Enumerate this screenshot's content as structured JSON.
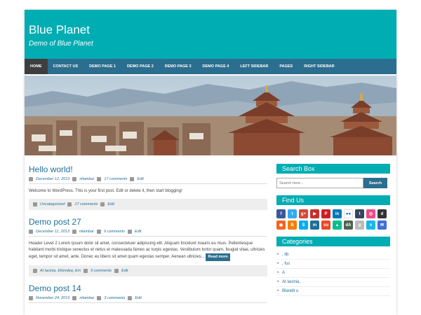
{
  "site": {
    "title": "Blue Planet",
    "description": "Demo of Blue Planet"
  },
  "nav": {
    "items": [
      "HOME",
      "CONTACT US",
      "DEMO PAGE 1",
      "DEMO PAGE 2",
      "DEMO PAGE 3",
      "DEMO PAGE 4",
      "LEFT SIDEBAR",
      "PAGES",
      "RIGHT SIDEBAR"
    ],
    "active": "HOME"
  },
  "posts": [
    {
      "title": "Hello world!",
      "date": "December 12, 2013",
      "author": "nilambar",
      "comments": "17 comments",
      "edit": "Edit",
      "excerpt": "Welcome to WordPress. This is your first post. Edit or delete it, then start blogging!",
      "categories": "Uncategorized",
      "footer_comments": "17 comments",
      "footer_edit": "Edit"
    },
    {
      "title": "Demo post 27",
      "date": "December 11, 2013",
      "author": "nilambar",
      "comments": "9 comments",
      "edit": "Edit",
      "excerpt": "Header Level 2 Lorem ipsum dolor sit amet, consectetuer adipiscing elit. Aliquam tincidunt mauris eu risus. Pellentesque habitant morbi tristique senectus et netus et malesuada fames ac turpis egestas. Vestibulum tortor quam, feugiat vitae, ultricies eget, tempor sit amet, ante. Donec eu libero sit amet quam egestas semper. Aenean ultricies...",
      "read_more": "Read more",
      "categories": "At lacinia, Ellendeq, Em",
      "footer_comments": "9 comments",
      "footer_edit": "Edit"
    },
    {
      "title": "Demo post 14",
      "date": "November 24, 2013",
      "author": "nilambar",
      "comments": "3 comments",
      "edit": "Edit"
    }
  ],
  "sidebar": {
    "search_title": "Search Box",
    "search_placeholder": "Search here...",
    "search_button": "Search",
    "find_us_title": "Find Us",
    "social_icons": [
      {
        "name": "facebook-icon",
        "glyph": "f",
        "color": "#3b5998"
      },
      {
        "name": "twitter-icon",
        "glyph": "t",
        "color": "#33aaf3"
      },
      {
        "name": "google-plus-icon",
        "glyph": "g+",
        "color": "#d34836"
      },
      {
        "name": "youtube-icon",
        "glyph": "▶",
        "color": "#c4302b"
      },
      {
        "name": "pinterest-icon",
        "glyph": "P",
        "color": "#cb2027"
      },
      {
        "name": "linkedin-icon",
        "glyph": "in",
        "color": "#0077b5"
      },
      {
        "name": "flickr-icon",
        "glyph": "●●",
        "color": "#ffffff"
      },
      {
        "name": "tumblr-icon",
        "glyph": "t",
        "color": "#35465c"
      },
      {
        "name": "dribbble-icon",
        "glyph": "◎",
        "color": "#ea4c89"
      },
      {
        "name": "digg-icon",
        "glyph": "d",
        "color": "#333333"
      },
      {
        "name": "rss-icon",
        "glyph": "◉",
        "color": "#f26522"
      },
      {
        "name": "blogger-icon",
        "glyph": "B",
        "color": "#f57d00"
      },
      {
        "name": "skype-icon",
        "glyph": "S",
        "color": "#00aff0"
      },
      {
        "name": "myspace-icon",
        "glyph": "m",
        "color": "#1f6e97"
      },
      {
        "name": "stumbleupon-icon",
        "glyph": "su",
        "color": "#eb4924"
      },
      {
        "name": "vine-icon",
        "glyph": "▲",
        "color": "#00bf8f"
      },
      {
        "name": "deviantart-icon",
        "glyph": "dA",
        "color": "#4e6252"
      },
      {
        "name": "goodreads-icon",
        "glyph": "g",
        "color": "#bbbbbb"
      },
      {
        "name": "vimeo-icon",
        "glyph": "v",
        "color": "#1ab7ea"
      },
      {
        "name": "email-icon",
        "glyph": "✉",
        "color": "#3f6fd8"
      }
    ],
    "categories_title": "Categories",
    "categories": [
      ", lib",
      ", fus",
      "A",
      "At lacinia,",
      "Blandit u"
    ]
  },
  "colors": {
    "header": "#00adb3",
    "nav": "#2c6e8f",
    "link": "#1f6e97"
  }
}
